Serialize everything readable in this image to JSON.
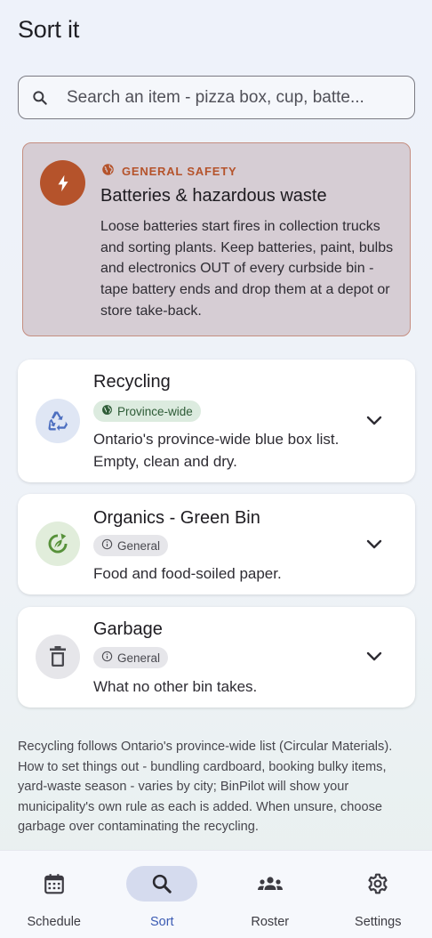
{
  "header": {
    "title": "Sort it"
  },
  "search": {
    "placeholder": "Search an item - pizza box, cup, batte..."
  },
  "safety": {
    "kicker": "GENERAL SAFETY",
    "title": "Batteries & hazardous waste",
    "body": "Loose batteries start fires in collection trucks and sorting plants. Keep batteries, paint, bulbs and electronics OUT of every curbside bin - tape battery ends and drop them at a depot or store take-back.",
    "icon": "bolt-icon",
    "accent": "#b5532b"
  },
  "bins": [
    {
      "title": "Recycling",
      "chip": "Province-wide",
      "chip_icon": "globe-icon",
      "description": "Ontario's province-wide blue box list. Empty, clean and dry.",
      "icon": "recycle-icon",
      "icon_color": "#4d6fc0",
      "icon_bg": "#dfe6f4"
    },
    {
      "title": "Organics - Green Bin",
      "chip": "General",
      "chip_icon": "info-icon",
      "description": "Food and food-soiled paper.",
      "icon": "compost-icon",
      "icon_color": "#57913a",
      "icon_bg": "#e1eddb"
    },
    {
      "title": "Garbage",
      "chip": "General",
      "chip_icon": "info-icon",
      "description": "What no other bin takes.",
      "icon": "trash-icon",
      "icon_color": "#4a4a50",
      "icon_bg": "#e6e6ea"
    }
  ],
  "footnote": "Recycling follows Ontario's province-wide list (Circular Materials). How to set things out - bundling cardboard, booking bulky items, yard-waste season - varies by city; BinPilot will show your municipality's own rule as each is added. When unsure, choose garbage over contaminating the recycling.",
  "nav": [
    {
      "label": "Schedule",
      "icon": "calendar-icon",
      "active": false
    },
    {
      "label": "Sort",
      "icon": "search-icon",
      "active": true
    },
    {
      "label": "Roster",
      "icon": "group-icon",
      "active": false
    },
    {
      "label": "Settings",
      "icon": "gear-icon",
      "active": false
    }
  ]
}
